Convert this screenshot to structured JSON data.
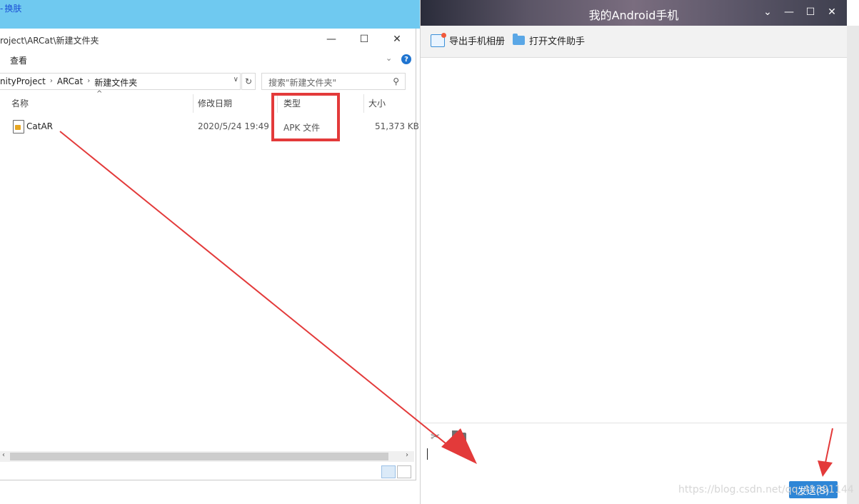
{
  "background_app": {
    "skin_link": "换肤"
  },
  "explorer": {
    "title": "roject\\ARCat\\新建文件夹",
    "ribbon_view": "查看",
    "help": "?",
    "breadcrumbs": [
      "nityProject",
      "ARCat",
      "新建文件夹"
    ],
    "search_placeholder": "搜索\"新建文件夹\"",
    "columns": {
      "name": "名称",
      "modified": "修改日期",
      "type": "类型",
      "size": "大小"
    },
    "files": [
      {
        "name": "CatAR",
        "modified": "2020/5/24 19:49",
        "type": "APK 文件",
        "size": "51,373 KB"
      }
    ]
  },
  "phone_window": {
    "title": "我的Android手机",
    "toolbar": {
      "export_album": "导出手机相册",
      "open_file_helper": "打开文件助手"
    },
    "send_button": "发送(S)"
  },
  "watermark": "https://blog.csdn.net/qq_41391144",
  "colors": {
    "annotation_red": "#e33a3a",
    "send_blue": "#2f86d6",
    "strip_cyan": "#6fc9f0"
  }
}
